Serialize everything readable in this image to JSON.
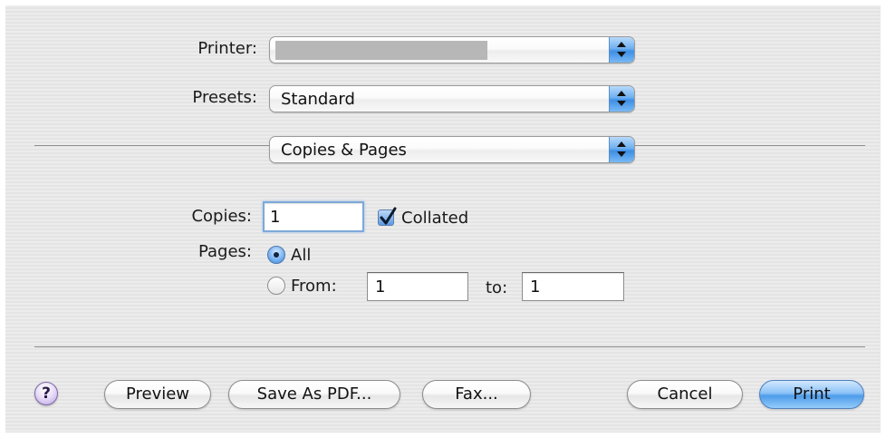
{
  "printer": {
    "label": "Printer:",
    "value": ""
  },
  "presets": {
    "label": "Presets:",
    "value": "Standard"
  },
  "panel": {
    "value": "Copies & Pages"
  },
  "copies": {
    "label": "Copies:",
    "value": "1",
    "collated_label": "Collated",
    "collated_checked": true
  },
  "pages": {
    "label": "Pages:",
    "all_label": "All",
    "all_selected": true,
    "from_label": "From:",
    "from_value": "1",
    "to_label": "to:",
    "to_value": "1"
  },
  "buttons": {
    "help": "?",
    "preview": "Preview",
    "save_as_pdf": "Save As PDF...",
    "fax": "Fax...",
    "cancel": "Cancel",
    "print": "Print"
  }
}
